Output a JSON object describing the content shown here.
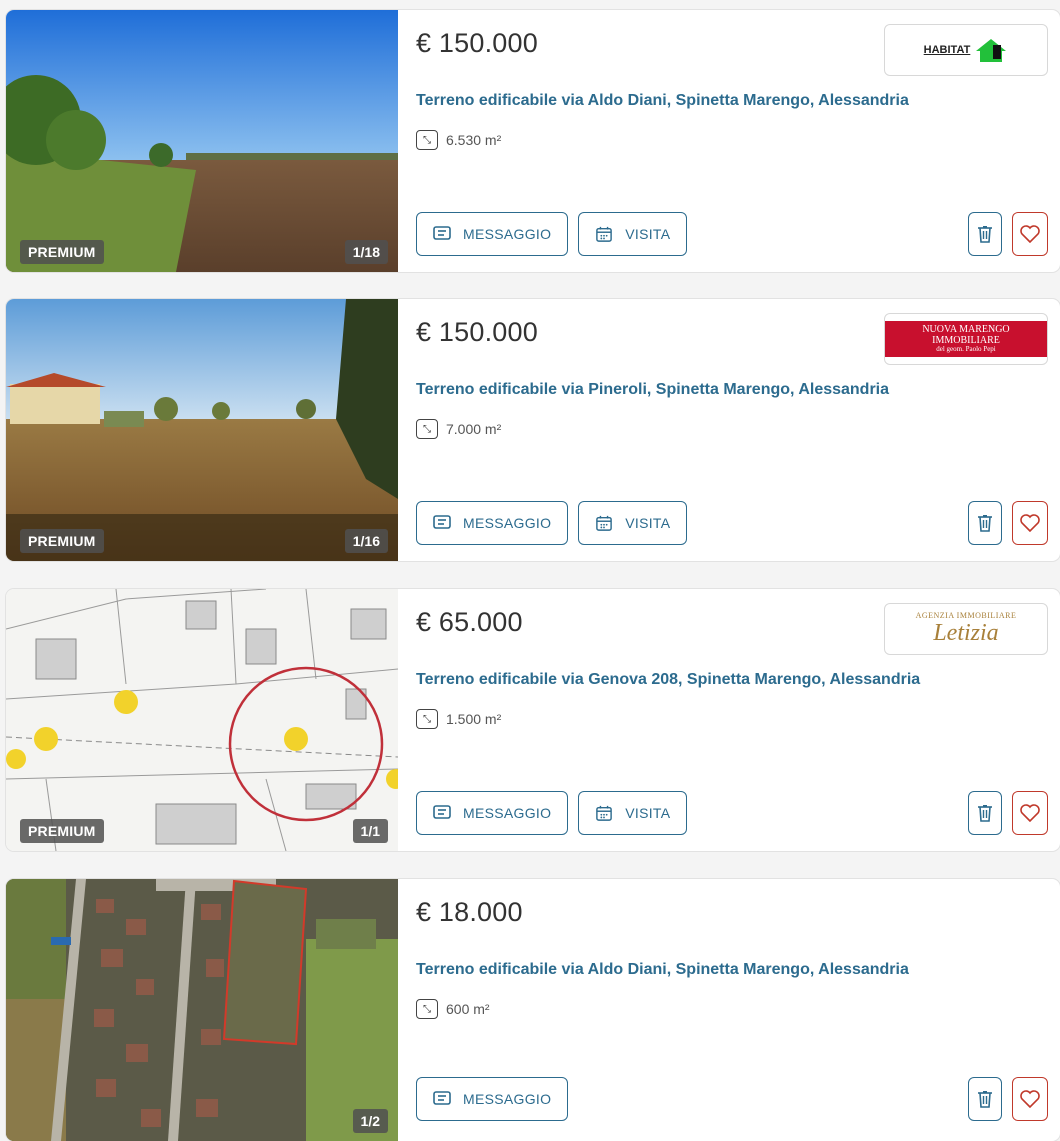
{
  "listings": [
    {
      "price": "€ 150.000",
      "title": "Terreno edificabile via Aldo Diani, Spinetta Marengo, Alessandria",
      "surface": "6.530 m²",
      "badge": "PREMIUM",
      "counter": "1/18",
      "logo": "HABITAT",
      "buttons": {
        "message": "MESSAGGIO",
        "visit": "VISITA"
      }
    },
    {
      "price": "€ 150.000",
      "title": "Terreno edificabile via Pineroli, Spinetta Marengo, Alessandria",
      "surface": "7.000 m²",
      "badge": "PREMIUM",
      "counter": "1/16",
      "logo": "NUOVA MARENGO IMMOBILIARE",
      "logo_sub": "del geom. Paolo Pepi",
      "buttons": {
        "message": "MESSAGGIO",
        "visit": "VISITA"
      }
    },
    {
      "price": "€ 65.000",
      "title": "Terreno edificabile via Genova 208, Spinetta Marengo, Alessandria",
      "surface": "1.500 m²",
      "badge": "PREMIUM",
      "counter": "1/1",
      "logo": "Letizia",
      "logo_sub": "AGENZIA IMMOBILIARE",
      "buttons": {
        "message": "MESSAGGIO",
        "visit": "VISITA"
      }
    },
    {
      "price": "€ 18.000",
      "title": "Terreno edificabile via Aldo Diani, Spinetta Marengo, Alessandria",
      "surface": "600 m²",
      "counter": "1/2",
      "buttons": {
        "message": "MESSAGGIO"
      }
    }
  ],
  "colors": {
    "accent": "#2c6b8e",
    "heart": "#c0392b",
    "text": "#333333"
  },
  "icons": [
    "expand-icon",
    "message-icon",
    "calendar-icon",
    "trash-icon",
    "heart-icon"
  ]
}
